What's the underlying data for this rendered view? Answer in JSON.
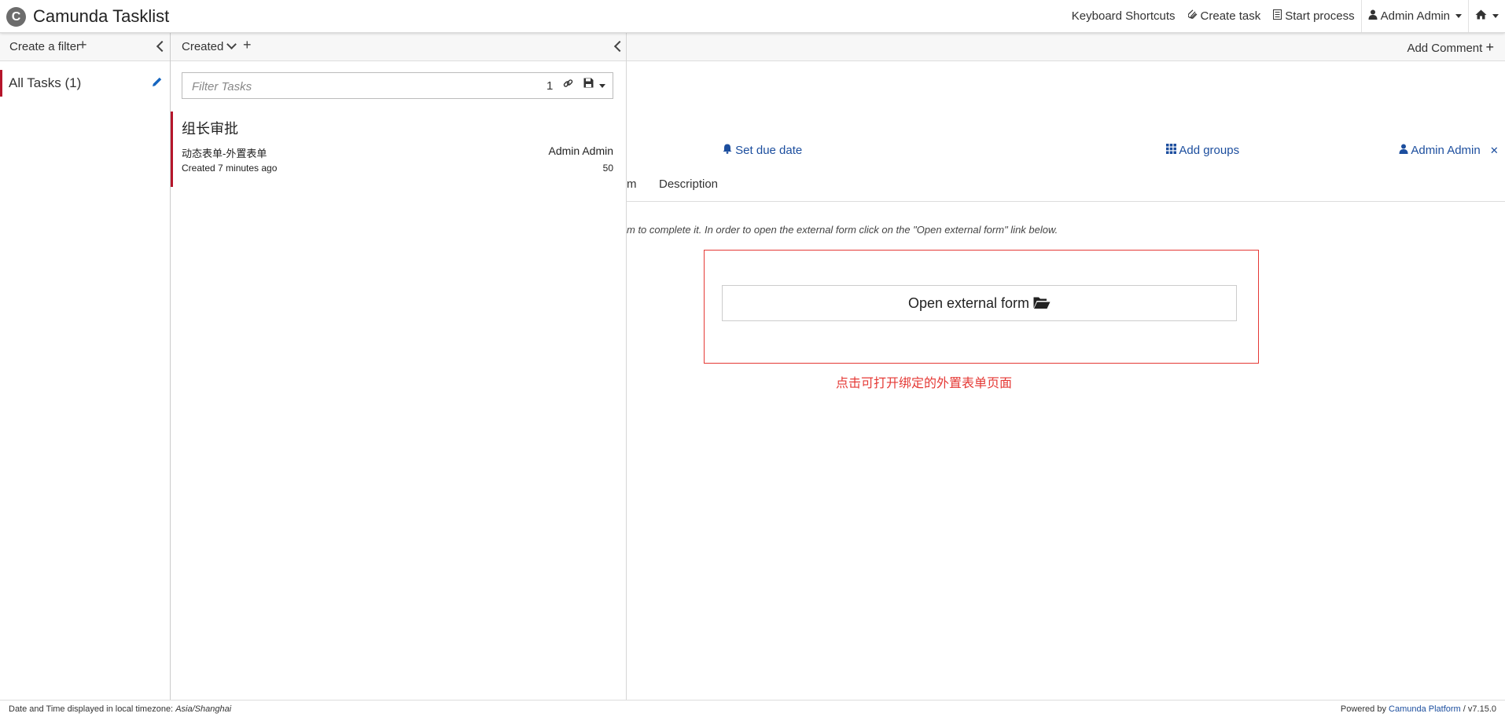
{
  "header": {
    "logo_letter": "C",
    "brand": "Camunda Tasklist",
    "keyboard_shortcuts": "Keyboard Shortcuts",
    "create_task": "Create task",
    "start_process": "Start process",
    "user": "Admin Admin"
  },
  "filters": {
    "create_filter": "Create a filter",
    "items": [
      {
        "label": "All Tasks (1)"
      }
    ]
  },
  "tasklist": {
    "sort_label": "Created",
    "search": {
      "placeholder": "Filter Tasks",
      "count": "1"
    },
    "tasks": [
      {
        "name": "组长审批",
        "process": "动态表单-外置表单",
        "assignee": "Admin Admin",
        "created": "Created 7 minutes ago",
        "priority": "50"
      }
    ]
  },
  "detail": {
    "add_comment": "Add Comment",
    "actions": {
      "set_due_date": "Set due date",
      "add_groups": "Add groups",
      "assignee": "Admin Admin"
    },
    "tabs": [
      "m",
      "Description"
    ],
    "info": "m to complete it. In order to open the external form click on the \"Open external form\" link below.",
    "open_button": "Open external form",
    "annotation": "点击可打开绑定的外置表单页面"
  },
  "footer": {
    "timezone_prefix": "Date and Time displayed in local timezone:",
    "timezone": "Asia/Shanghai",
    "powered_prefix": "Powered by",
    "platform": "Camunda Platform",
    "version": "/ v7.15.0"
  },
  "colors": {
    "accent_red": "#b5152b",
    "link_blue": "#1c4e9e",
    "annotation_red": "#e53935"
  }
}
